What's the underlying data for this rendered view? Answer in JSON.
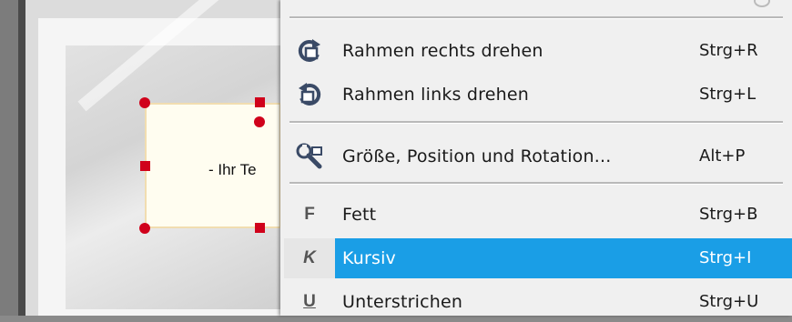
{
  "editor": {
    "text_frame_label": "- Ihr Te"
  },
  "context_menu": {
    "items": [
      {
        "label": "Rahmen rechts drehen",
        "shortcut": "Strg+R",
        "icon": "rotate-right-icon"
      },
      {
        "label": "Rahmen links drehen",
        "shortcut": "Strg+L",
        "icon": "rotate-left-icon"
      },
      {
        "label": "Größe, Position und Rotation...",
        "shortcut": "Alt+P",
        "icon": "wrench-icon"
      },
      {
        "label": "Fett",
        "shortcut": "Strg+B",
        "icon": "bold-icon",
        "icon_text": "F"
      },
      {
        "label": "Kursiv",
        "shortcut": "Strg+I",
        "icon": "italic-icon",
        "icon_text": "K",
        "highlighted": true
      },
      {
        "label": "Unterstrichen",
        "shortcut": "Strg+U",
        "icon": "underline-icon",
        "icon_text": "U"
      }
    ]
  },
  "colors": {
    "highlight": "#1a9ee6",
    "selection_handle": "#d0021b",
    "icon_dark": "#3a4a66"
  }
}
